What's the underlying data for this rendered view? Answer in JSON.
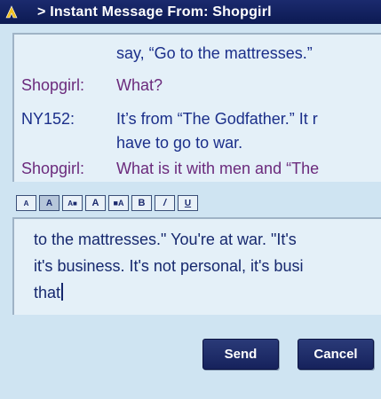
{
  "window": {
    "title": "> Instant Message From: Shopgirl"
  },
  "transcript": {
    "messages": [
      {
        "speaker": "",
        "text": "say, “Go to the mattresses.”",
        "who": "ny152"
      },
      {
        "speaker": "Shopgirl:",
        "text": "What?",
        "who": "shopgirl"
      },
      {
        "speaker": "NY152:",
        "text": "It’s from “The Godfather.”  It r",
        "who": "ny152"
      },
      {
        "speaker": "",
        "text": "have to go to war.",
        "who": "ny152"
      },
      {
        "speaker": "Shopgirl:",
        "text": "What is it with men and “The",
        "who": "shopgirl"
      }
    ]
  },
  "format_toolbar": {
    "buttons": [
      {
        "label": "A",
        "icon": "decrease-font-size-icon"
      },
      {
        "label": "A",
        "icon": "normal-font-size-icon"
      },
      {
        "label": "A■",
        "icon": "background-color-icon"
      },
      {
        "label": "A",
        "icon": "text-color-icon"
      },
      {
        "label": "■A",
        "icon": "increase-font-size-icon"
      },
      {
        "label": "B",
        "icon": "bold-icon"
      },
      {
        "label": "/",
        "icon": "italic-icon"
      },
      {
        "label": "U",
        "icon": "underline-icon"
      }
    ]
  },
  "compose": {
    "lines": [
      "to the mattresses.\"  You're at war.  \"It's",
      "it's business.  It's not personal, it's busi",
      "that"
    ]
  },
  "actions": {
    "send_label": "Send",
    "cancel_label": "Cancel"
  },
  "colors": {
    "titlebar": "#0c1a52",
    "shopgirl_text": "#6b2a7c",
    "ny152_text": "#1b2f8a",
    "button": "#1f2d6a"
  }
}
